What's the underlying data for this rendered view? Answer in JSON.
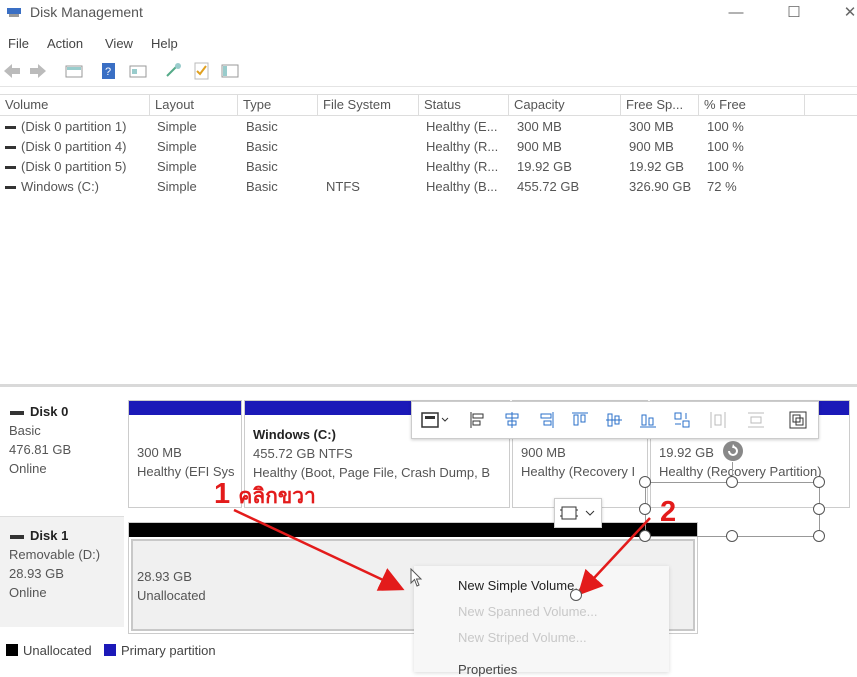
{
  "window": {
    "title": "Disk Management",
    "minimize": "—",
    "maximize": "☐",
    "close": "✕"
  },
  "menu": [
    "File",
    "Action",
    "View",
    "Help"
  ],
  "columns": [
    "Volume",
    "Layout",
    "Type",
    "File System",
    "Status",
    "Capacity",
    "Free Sp...",
    "% Free"
  ],
  "volumes": [
    [
      "(Disk 0 partition 1)",
      "Simple",
      "Basic",
      "",
      "Healthy (E...",
      "300 MB",
      "300 MB",
      "100 %"
    ],
    [
      "(Disk 0 partition 4)",
      "Simple",
      "Basic",
      "",
      "Healthy (R...",
      "900 MB",
      "900 MB",
      "100 %"
    ],
    [
      "(Disk 0 partition 5)",
      "Simple",
      "Basic",
      "",
      "Healthy (R...",
      "19.92 GB",
      "19.92 GB",
      "100 %"
    ],
    [
      "Windows (C:)",
      "Simple",
      "Basic",
      "NTFS",
      "Healthy (B...",
      "455.72 GB",
      "326.90 GB",
      "72 %"
    ]
  ],
  "disks": {
    "disk0": {
      "name": "Disk 0",
      "type": "Basic",
      "size": "476.81 GB",
      "status": "Online",
      "partitions": [
        {
          "line1": "300 MB",
          "line2": "Healthy (EFI Sys"
        },
        {
          "title": "Windows  (C:)",
          "line1": "455.72 GB NTFS",
          "line2": "Healthy (Boot, Page File, Crash Dump, B"
        },
        {
          "line1": "900 MB",
          "line2": "Healthy (Recovery I"
        },
        {
          "line1": "19.92 GB",
          "line2": "Healthy (Recovery Partition)"
        }
      ]
    },
    "disk1": {
      "name": "Disk 1",
      "type": "Removable (D:)",
      "size": "28.93 GB",
      "status": "Online",
      "partition": {
        "line1": "28.93 GB",
        "line2": "Unallocated"
      }
    }
  },
  "legend": {
    "unallocated": "Unallocated",
    "primary": "Primary partition"
  },
  "context_menu": [
    "New Simple Volume...",
    "New Spanned Volume...",
    "New Striped Volume...",
    "Properties"
  ],
  "annotations": {
    "step1_number": "1",
    "step1_text": "คลิกขวา",
    "step2_number": "2"
  },
  "colors": {
    "primary_partition": "#1b19b8",
    "unallocated": "#000000",
    "annotation": "#e31b1b"
  }
}
